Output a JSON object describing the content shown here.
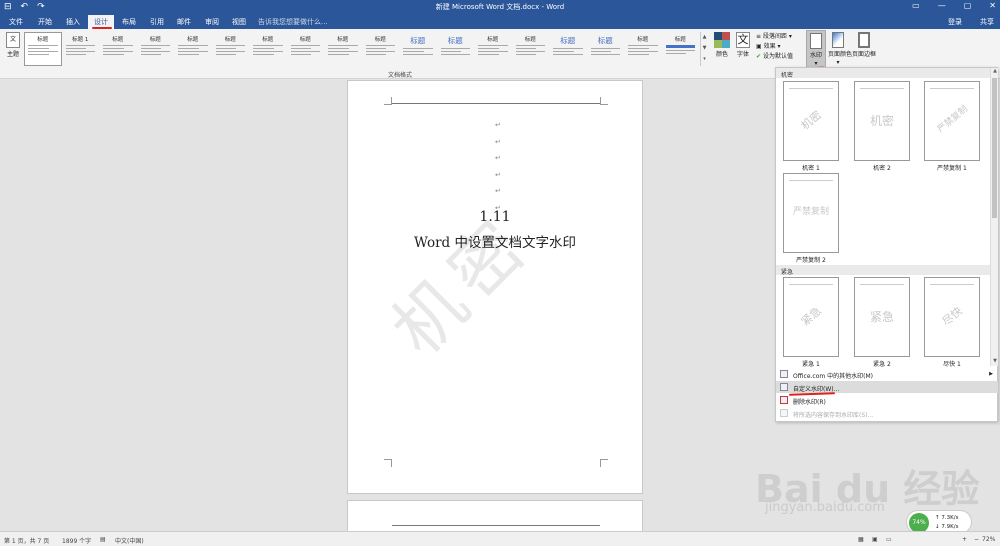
{
  "titlebar": {
    "title": "新建 Microsoft Word 文档.docx - Word",
    "qat": [
      "⊟",
      "↶",
      "↷"
    ],
    "controls": [
      "▭",
      "—",
      "▢",
      "✕"
    ]
  },
  "tabs": [
    "文件",
    "开始",
    "插入",
    "设计",
    "布局",
    "引用",
    "邮件",
    "审阅",
    "视图"
  ],
  "active_tab": "设计",
  "tell_me": "告诉我您想要做什么...",
  "login": "登录",
  "share": "共享",
  "ribbon": {
    "theme_label": "主题",
    "theme_icon_text": "文",
    "styles": [
      {
        "title": "标题"
      },
      {
        "title": "标题 1"
      },
      {
        "title": "标题"
      },
      {
        "title": "标题"
      },
      {
        "title": "标题"
      },
      {
        "title": "标题"
      },
      {
        "title": "标题"
      },
      {
        "title": "标题"
      },
      {
        "title": "标题"
      },
      {
        "title": "标题"
      },
      {
        "title": "标题"
      },
      {
        "title": "标题"
      },
      {
        "title": "标题"
      },
      {
        "title": "标题"
      },
      {
        "title": "标题"
      },
      {
        "title": "标题"
      },
      {
        "title": "标题"
      },
      {
        "title": "标题"
      }
    ],
    "group_label": "文档格式",
    "colors_label": "颜色",
    "fonts_label": "字体",
    "fonts_icon_text": "文",
    "paragraph_spacing": "段落间距",
    "effects": "效果",
    "set_default": "设为默认值",
    "watermark": "水印",
    "page_color": "页面颜色",
    "page_borders": "页面边框",
    "scroll_up": "▲",
    "scroll_down": "▼",
    "more": "▾"
  },
  "document": {
    "para_marks": [
      "↵",
      "↵",
      "↵",
      "↵",
      "↵",
      "↵"
    ],
    "heading_number": "1.11",
    "heading_text": "Word 中设置文档文字水印",
    "watermark_text": "机密"
  },
  "watermark_panel": {
    "section_confidential": "机密",
    "section_urgent": "紧急",
    "items": [
      {
        "name": "机密 1",
        "mark": "机密"
      },
      {
        "name": "机密 2",
        "mark": "机密"
      },
      {
        "name": "严禁复制 1",
        "mark": "严禁复制"
      },
      {
        "name": "严禁复制 2",
        "mark": "严禁复制"
      },
      {
        "name": "紧急 1",
        "mark": "紧急"
      },
      {
        "name": "紧急 2",
        "mark": "紧急"
      },
      {
        "name": "尽快 1",
        "mark": "尽快"
      }
    ],
    "menu": {
      "more_office": "Office.com 中的其他水印(M)",
      "custom": "自定义水印(W)...",
      "remove": "删除水印(R)",
      "save_selection": "将所选内容保存到水印库(S)..."
    }
  },
  "statusbar": {
    "page": "第 1 页，共 7 页",
    "words": "1899 个字",
    "language": "中文(中国)",
    "zoom": "72%",
    "zoom_minus": "−",
    "zoom_plus": "+"
  },
  "network": {
    "percent": "74%",
    "up": "7.3K/s",
    "down": "7.9K/s"
  },
  "overlay": {
    "brand": "Bai du 经验",
    "url": "jingyan.baidu.com"
  },
  "colors": {
    "brand_blue": "#2b579a",
    "annotation_red": "#d22222",
    "net_green": "#4cae4c"
  }
}
